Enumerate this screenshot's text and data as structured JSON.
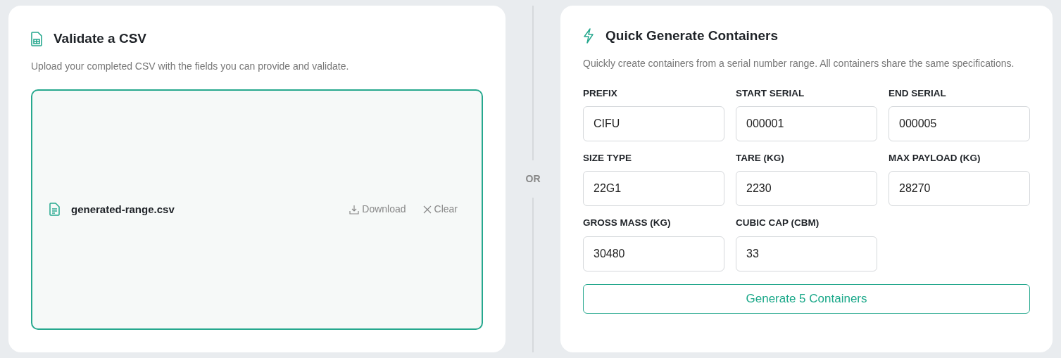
{
  "validate": {
    "title": "Validate a CSV",
    "description": "Upload your completed CSV with the fields you can provide and validate.",
    "file": {
      "name": "generated-range.csv",
      "actions": [
        "Download",
        "Clear"
      ]
    }
  },
  "separator": "OR",
  "generate": {
    "title": "Quick Generate Containers",
    "description": "Quickly create containers from a serial number range. All containers share the same specifications.",
    "fields": [
      {
        "label": "PREFIX",
        "value": "CIFU"
      },
      {
        "label": "START SERIAL",
        "value": "000001"
      },
      {
        "label": "END SERIAL",
        "value": "000005"
      },
      {
        "label": "SIZE TYPE",
        "value": "22G1"
      },
      {
        "label": "TARE (KG)",
        "value": "2230"
      },
      {
        "label": "MAX PAYLOAD (KG)",
        "value": "28270"
      },
      {
        "label": "GROSS MASS (KG)",
        "value": "30480"
      },
      {
        "label": "CUBIC CAP (CBM)",
        "value": "33"
      }
    ],
    "button": "Generate 5 Containers"
  }
}
